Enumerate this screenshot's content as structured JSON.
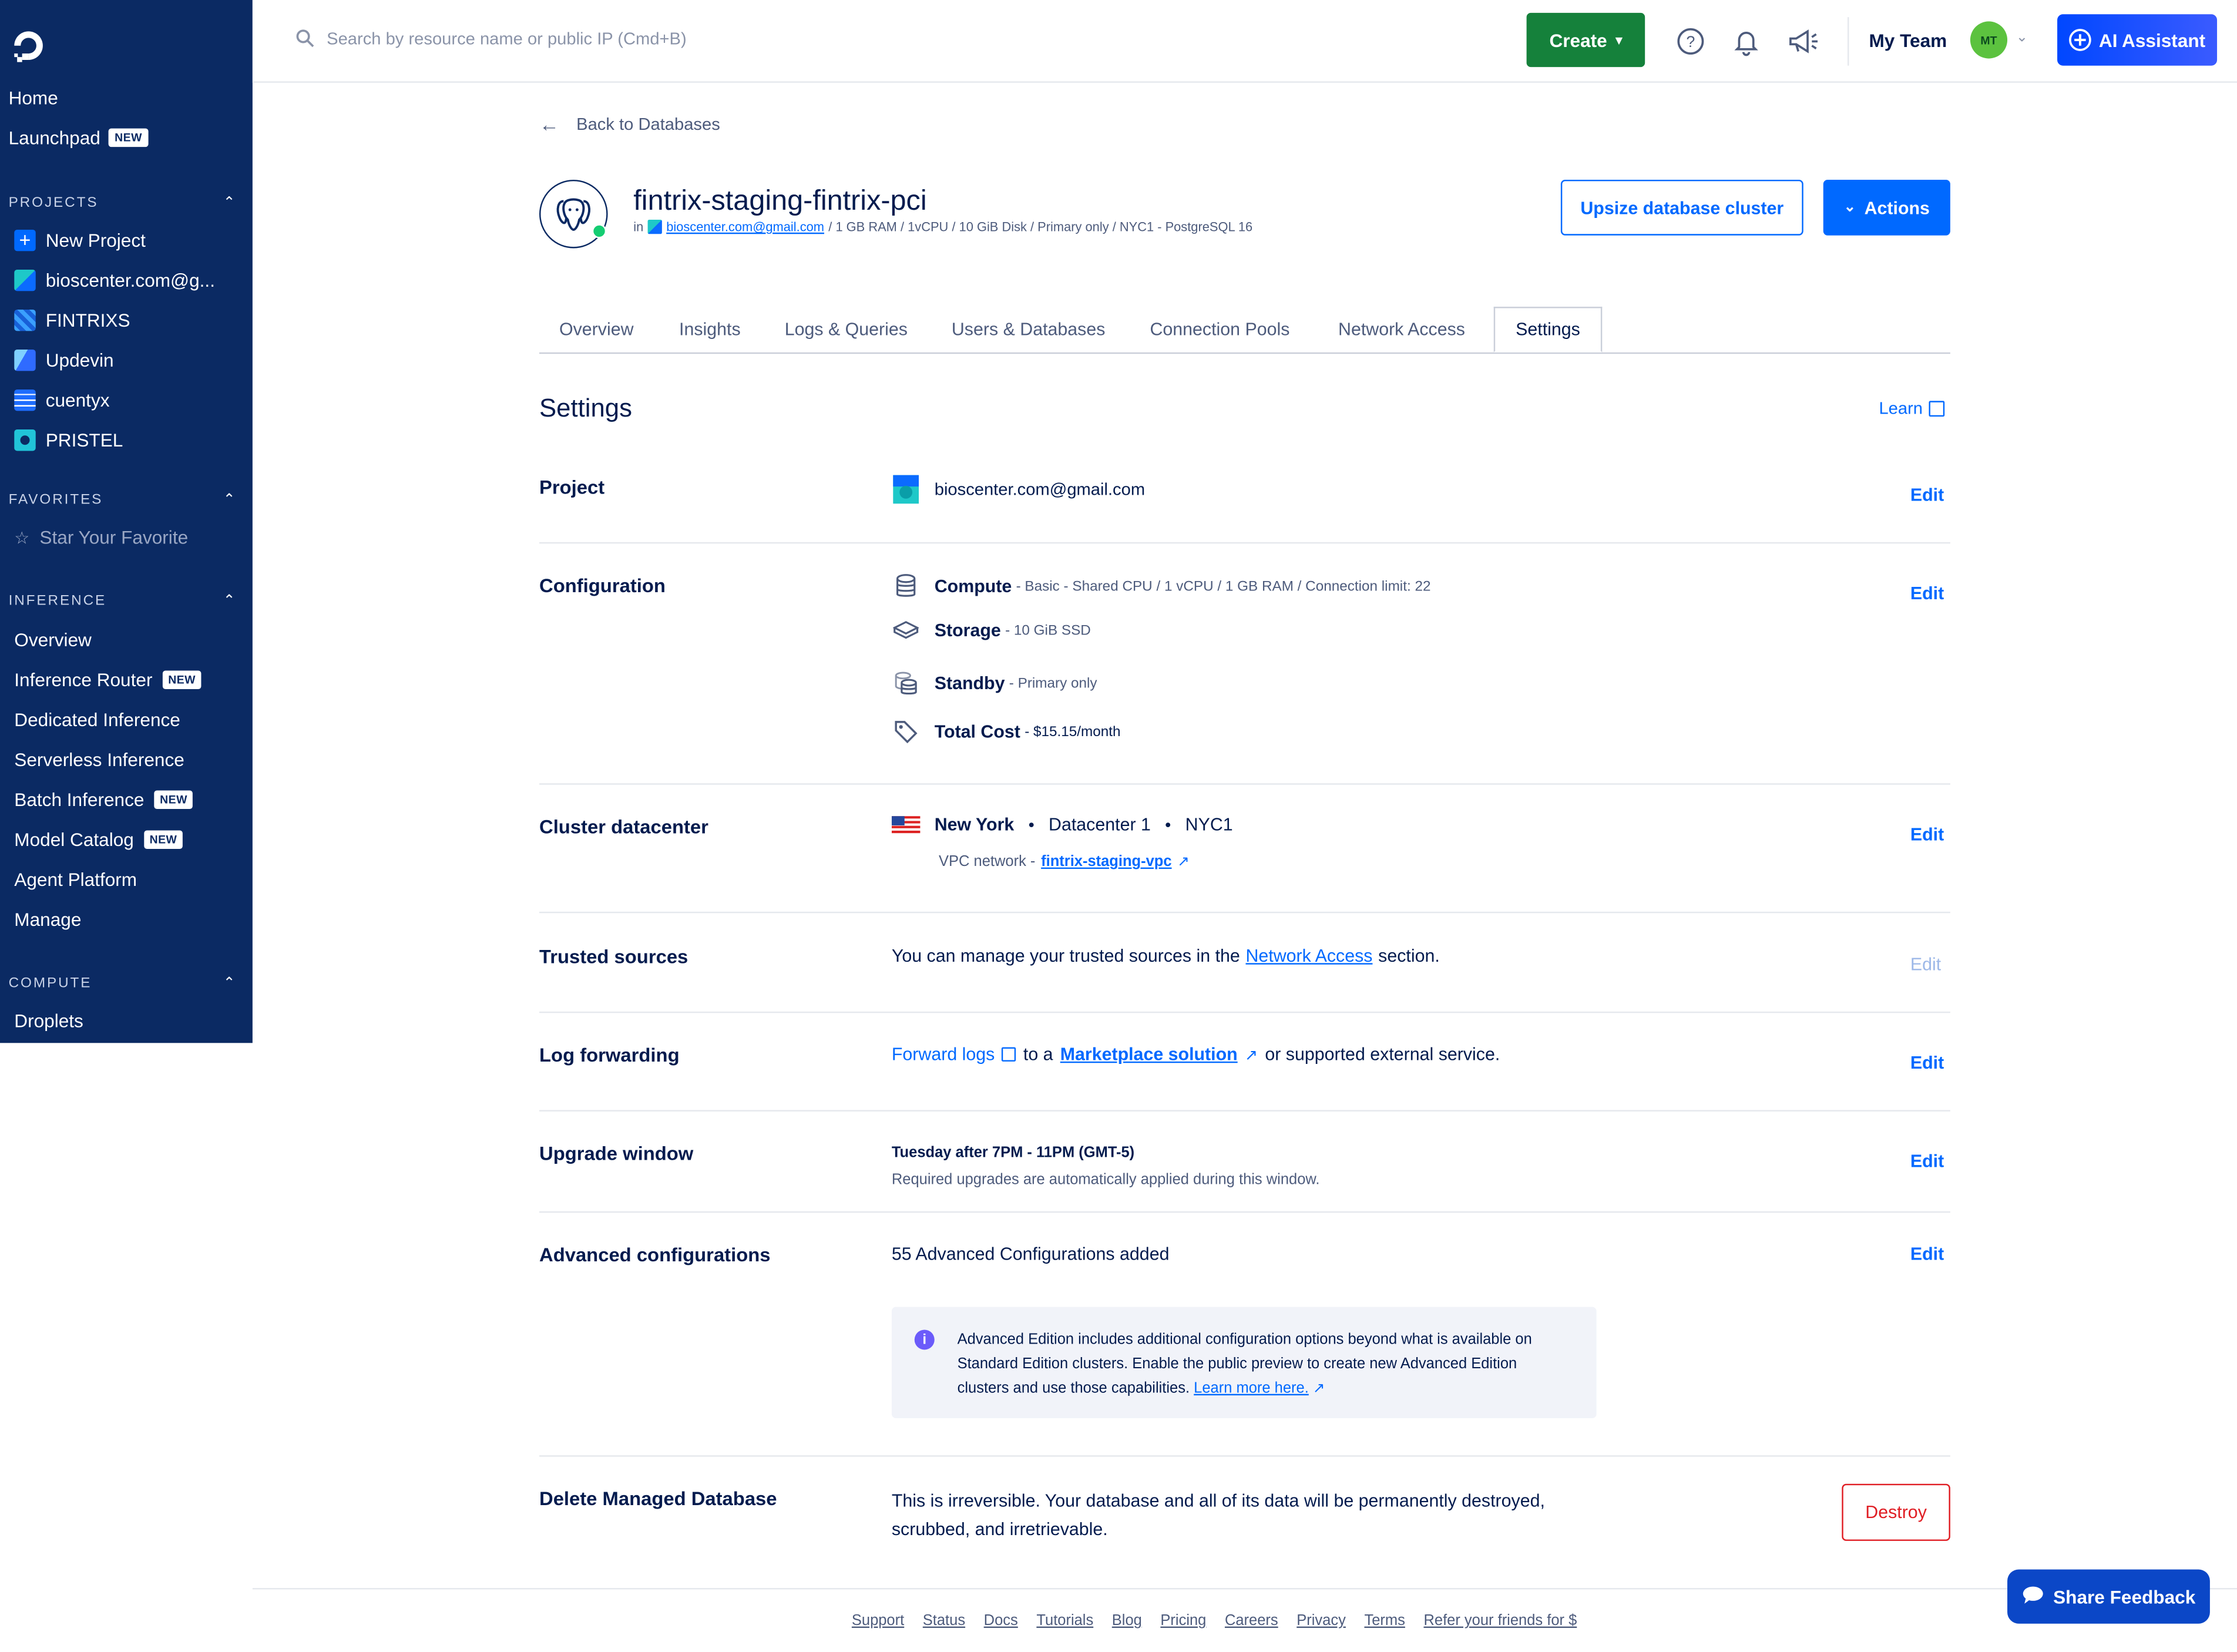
{
  "search": {
    "placeholder": "Search by resource name or public IP (Cmd+B)"
  },
  "topbar": {
    "create_label": "Create",
    "team_label": "My Team",
    "avatar_initials": "MT",
    "ai_label": "AI Assistant"
  },
  "sidebar": {
    "home": "Home",
    "launchpad": "Launchpad",
    "new_badge": "NEW",
    "projects_heading": "PROJECTS",
    "projects": [
      {
        "label": "New Project",
        "color": "#0069ff"
      },
      {
        "label": "bioscenter.com@g...",
        "color": "#1ec8c8"
      },
      {
        "label": "FINTRIXS",
        "color": "#3aa0ff"
      },
      {
        "label": "Updevin",
        "color": "#2f8cff"
      },
      {
        "label": "cuentyx",
        "color": "#1e6dff"
      },
      {
        "label": "PRISTEL",
        "color": "#21c4d8"
      }
    ],
    "favorites_heading": "FAVORITES",
    "favorite_placeholder": "Star Your Favorite",
    "inference_heading": "INFERENCE",
    "inference_items": [
      "Overview",
      "Inference Router",
      "Dedicated Inference",
      "Serverless Inference",
      "Batch Inference",
      "Model Catalog",
      "Agent Platform",
      "Manage"
    ],
    "compute_heading": "COMPUTE",
    "compute_items": [
      "Droplets"
    ]
  },
  "header": {
    "back_label": "Back to Databases",
    "db_name": "fintrix-staging-fintrix-pci",
    "meta_in": "in",
    "meta_project": "bioscenter.com@gmail.com",
    "meta_specs": "/ 1 GB RAM / 1vCPU / 10 GiB Disk / Primary only / NYC1 - PostgreSQL 16",
    "upsize_label": "Upsize database cluster",
    "actions_label": "Actions"
  },
  "tabs": [
    "Overview",
    "Insights",
    "Logs & Queries",
    "Users & Databases",
    "Connection Pools",
    "Network Access",
    "Settings"
  ],
  "settings": {
    "title": "Settings",
    "learn_label": "Learn",
    "edit_label": "Edit",
    "project": {
      "label": "Project",
      "value": "bioscenter.com@gmail.com"
    },
    "configuration": {
      "label": "Configuration",
      "compute_name": "Compute",
      "compute_detail": "- Basic - Shared CPU / 1 vCPU / 1 GB RAM / Connection limit: 22",
      "storage_name": "Storage",
      "storage_detail": "- 10 GiB SSD",
      "standby_name": "Standby",
      "standby_detail": "- Primary only",
      "cost_name": "Total Cost",
      "cost_detail": "- $15.15/month"
    },
    "datacenter": {
      "label": "Cluster datacenter",
      "city": "New York",
      "dc": "Datacenter 1",
      "code": "NYC1",
      "vpc_prefix": "VPC network -",
      "vpc_link": "fintrix-staging-vpc"
    },
    "trusted": {
      "label": "Trusted sources",
      "text_before": "You can manage your trusted sources in the",
      "link": "Network Access",
      "text_after": "section."
    },
    "log_forwarding": {
      "label": "Log forwarding",
      "link1": "Forward logs",
      "mid": "to a",
      "link2": "Marketplace solution",
      "after": "or supported external service."
    },
    "upgrade": {
      "label": "Upgrade window",
      "time": "Tuesday after 7PM - 11PM (GMT-5)",
      "note": "Required upgrades are automatically applied during this window."
    },
    "advanced": {
      "label": "Advanced configurations",
      "value": "55 Advanced Configurations added",
      "info": "Advanced Edition includes additional configuration options beyond what is available on Standard Edition clusters. Enable the public preview to create new Advanced Edition clusters and use those capabilities.",
      "info_link": "Learn more here."
    },
    "delete": {
      "label": "Delete Managed Database",
      "text": "This is irreversible. Your database and all of its data will be permanently destroyed, scrubbed, and irretrievable.",
      "button": "Destroy"
    }
  },
  "footer": {
    "links": [
      "Support",
      "Status",
      "Docs",
      "Tutorials",
      "Blog",
      "Pricing",
      "Careers",
      "Privacy",
      "Terms",
      "Refer your friends for $"
    ]
  },
  "feedback_label": "Share Feedback",
  "colors": {
    "sidebar": "#0b2a63",
    "primary": "#0069ff",
    "create": "#15813b",
    "danger": "#e01e24"
  }
}
